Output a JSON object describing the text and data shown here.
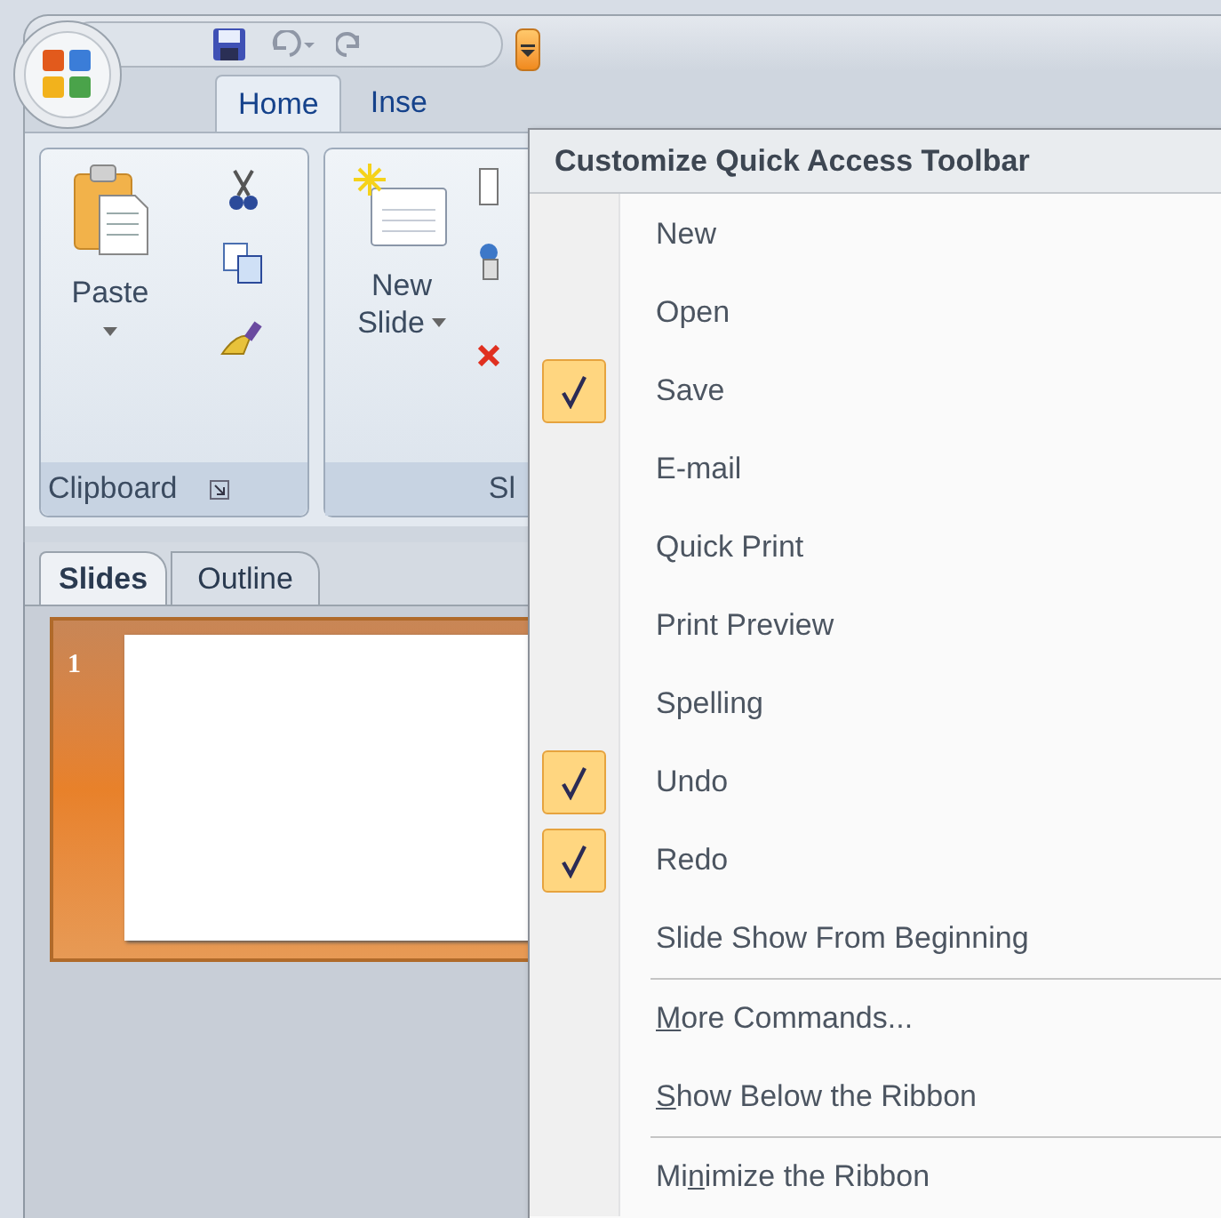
{
  "ribbon": {
    "tabs": [
      {
        "label": "Home",
        "selected": true
      },
      {
        "label": "Inse",
        "selected": false
      }
    ],
    "groups": [
      {
        "kind": "clipboard",
        "label": "Clipboard",
        "buttons": [
          "Paste"
        ]
      },
      {
        "kind": "slides",
        "label": "Sl",
        "buttons": [
          "New",
          "Slide"
        ]
      }
    ]
  },
  "pane_tabs": [
    {
      "label": "Slides",
      "selected": true
    },
    {
      "label": "Outline",
      "selected": false
    }
  ],
  "thumbnails": [
    {
      "number": "1",
      "selected": true
    }
  ],
  "menu": {
    "title": "Customize Quick Access Toolbar",
    "groups": [
      {
        "items": [
          {
            "kind": "toggle",
            "label": "New",
            "checked": false
          },
          {
            "kind": "toggle",
            "label": "Open",
            "checked": false
          },
          {
            "kind": "toggle",
            "label": "Save",
            "checked": true
          },
          {
            "kind": "toggle",
            "label": "E-mail",
            "checked": false
          },
          {
            "kind": "toggle",
            "label": "Quick Print",
            "checked": false
          },
          {
            "kind": "toggle",
            "label": "Print Preview",
            "checked": false
          },
          {
            "kind": "toggle",
            "label": "Spelling",
            "checked": false
          },
          {
            "kind": "toggle",
            "label": "Undo",
            "checked": true
          },
          {
            "kind": "toggle",
            "label": "Redo",
            "checked": true
          },
          {
            "kind": "toggle",
            "label": "Slide Show From Beginning",
            "checked": false
          }
        ]
      },
      {
        "items": [
          {
            "kind": "command",
            "access_key": "M",
            "after": "ore Commands..."
          },
          {
            "kind": "command",
            "access_key": "S",
            "after": "how Below the Ribbon"
          }
        ]
      },
      {
        "items": [
          {
            "kind": "command",
            "before": "Mi",
            "access_key": "n",
            "after": "imize the Ribbon"
          }
        ]
      }
    ]
  }
}
